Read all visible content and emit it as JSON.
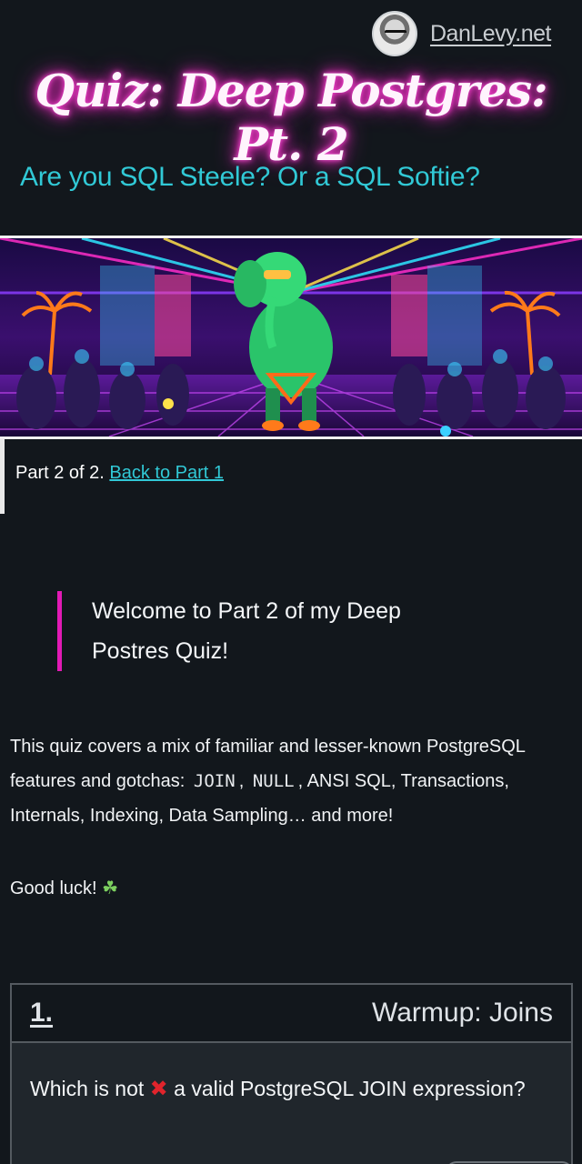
{
  "header": {
    "brand_link": "DanLevy.net",
    "title": "Quiz: Deep Postgres: Pt. 2",
    "subtitle": "Are you SQL Steele? Or a SQL Softie?"
  },
  "part_note": {
    "prefix": "Part 2 of 2.",
    "link": "Back to Part 1"
  },
  "quote": "Welcome to Part 2 of my Deep Postres Quiz!",
  "intro": {
    "text_before": "This quiz covers a mix of familiar and lesser-known PostgreSQL features and gotchas:",
    "code1": "JOIN",
    "sep": ",",
    "code2": "NULL",
    "text_after": ", ANSI SQL, Transactions, Internals, Indexing, Data Sampling… and more!"
  },
  "good_luck": "Good luck!",
  "question": {
    "number": "1.",
    "topic": "Warmup: Joins",
    "text_before": "Which is not",
    "text_after": "a valid PostgreSQL JOIN expression?"
  },
  "colors": {
    "accent_teal": "#31c9d6",
    "accent_pink": "#e21ab5",
    "background": "#12171c"
  },
  "icons": [
    "avatar",
    "clover-icon",
    "cross-mark-icon"
  ]
}
